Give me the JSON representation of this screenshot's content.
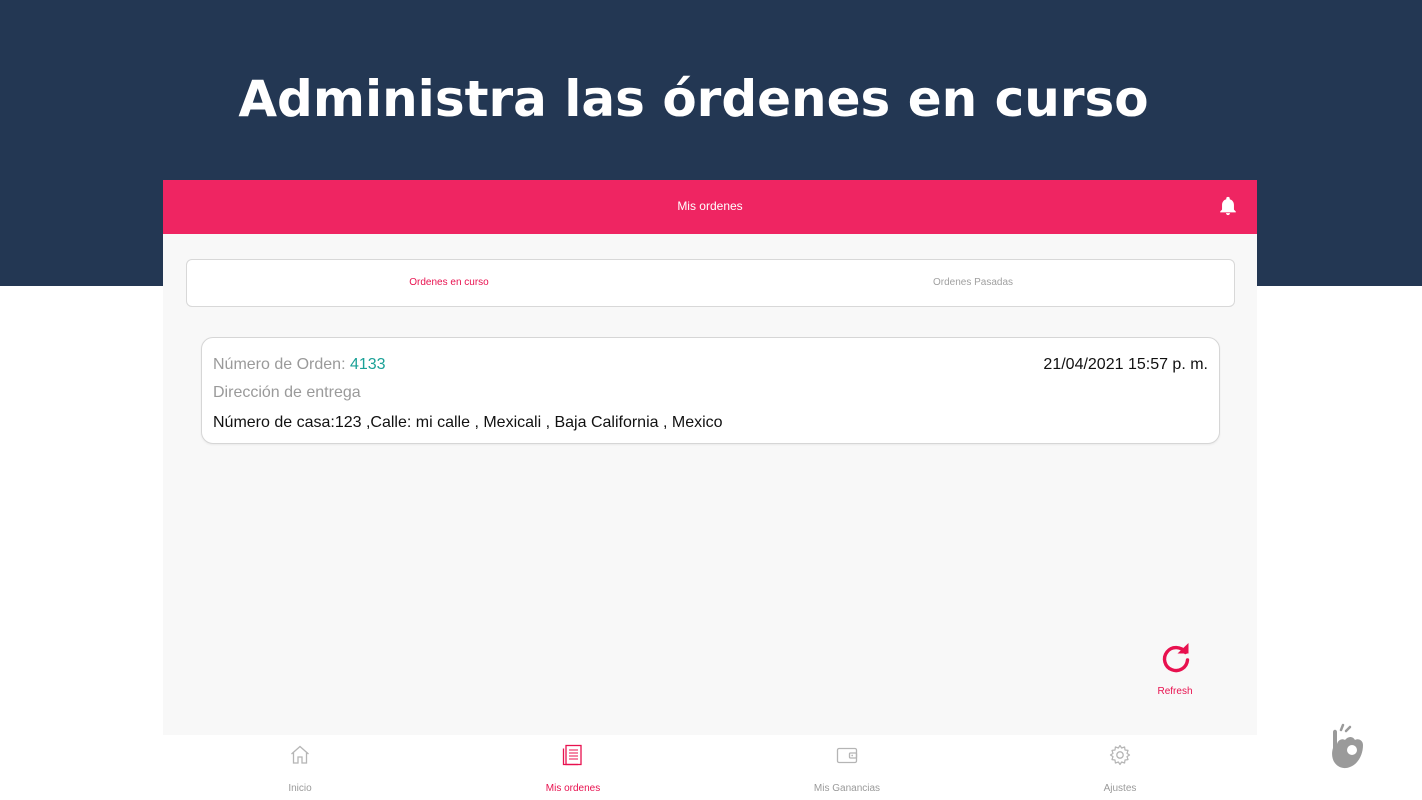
{
  "banner": {
    "title": "Administra las órdenes en curso"
  },
  "app_header": {
    "title": "Mis ordenes",
    "icon": "bell-icon"
  },
  "tabs": [
    {
      "label": "Ordenes en curso",
      "active": true
    },
    {
      "label": "Ordenes Pasadas",
      "active": false
    }
  ],
  "order": {
    "number_label": "Número de Orden: ",
    "number": "4133",
    "date": "21/04/2021 15:57 p. m.",
    "address_label": "Dirección de entrega",
    "address": "Número de casa:123 ,Calle: mi calle , Mexicali , Baja California , Mexico"
  },
  "refresh": {
    "label": "Refresh",
    "icon": "refresh-icon"
  },
  "bottom_nav": [
    {
      "label": "Inicio",
      "icon": "home-icon",
      "active": false
    },
    {
      "label": "Mis ordenes",
      "icon": "orders-icon",
      "active": true
    },
    {
      "label": "Mis Ganancias",
      "icon": "wallet-icon",
      "active": false
    },
    {
      "label": "Ajustes",
      "icon": "gear-icon",
      "active": false
    }
  ],
  "colors": {
    "banner": "#233753",
    "accent": "#ef2562",
    "order_number": "#1aa197",
    "inactive": "#9a9a9a"
  }
}
